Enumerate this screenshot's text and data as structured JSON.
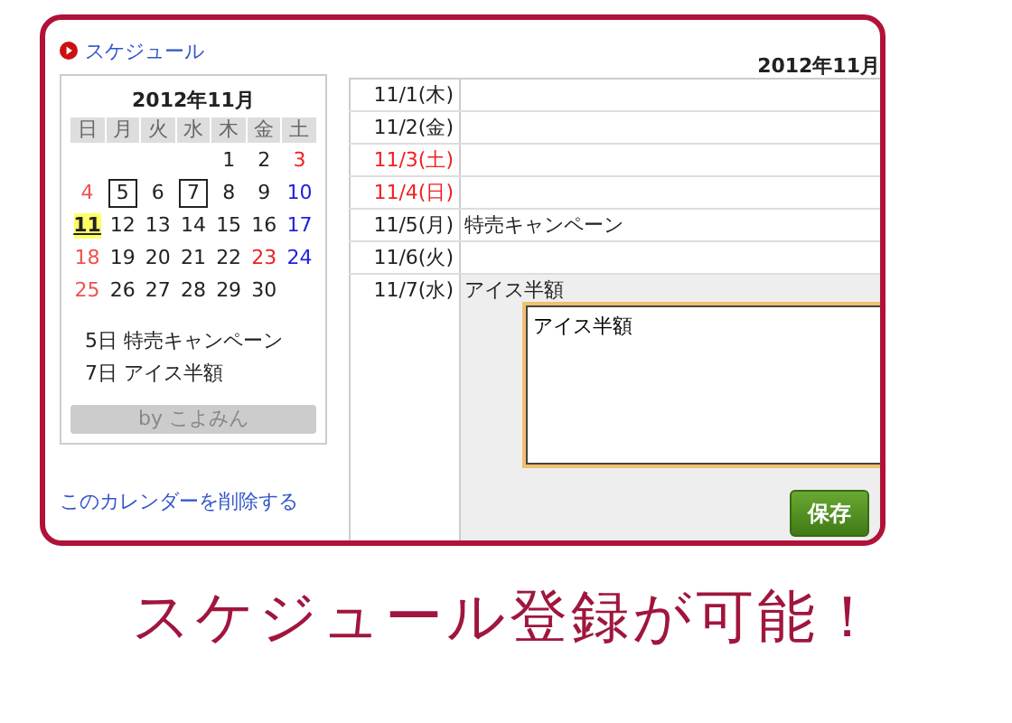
{
  "sidebar": {
    "link": "スケジュール",
    "calendar": {
      "title": "2012年11月",
      "weekdays": [
        {
          "label": "日"
        },
        {
          "label": "月"
        },
        {
          "label": "火"
        },
        {
          "label": "水"
        },
        {
          "label": "木"
        },
        {
          "label": "金"
        },
        {
          "label": "土"
        }
      ],
      "weeks": [
        [
          {
            "day": "1",
            "kind": "weekday",
            "has_event": false,
            "today": false
          },
          {
            "day": "2",
            "kind": "weekday",
            "has_event": false,
            "today": false
          },
          {
            "day": "3",
            "kind": "holiday",
            "has_event": false,
            "today": false
          }
        ],
        [
          {
            "day": "4",
            "kind": "sunday",
            "has_event": false,
            "today": false
          },
          {
            "day": "5",
            "kind": "weekday",
            "has_event": true,
            "today": false
          },
          {
            "day": "6",
            "kind": "weekday",
            "has_event": false,
            "today": false
          },
          {
            "day": "7",
            "kind": "weekday",
            "has_event": true,
            "today": false
          },
          {
            "day": "8",
            "kind": "weekday",
            "has_event": false,
            "today": false
          },
          {
            "day": "9",
            "kind": "weekday",
            "has_event": false,
            "today": false
          },
          {
            "day": "10",
            "kind": "saturday",
            "has_event": false,
            "today": false
          }
        ],
        [
          {
            "day": "11",
            "kind": "weekday",
            "has_event": false,
            "today": true
          },
          {
            "day": "12",
            "kind": "weekday",
            "has_event": false,
            "today": false
          },
          {
            "day": "13",
            "kind": "weekday",
            "has_event": false,
            "today": false
          },
          {
            "day": "14",
            "kind": "weekday",
            "has_event": false,
            "today": false
          },
          {
            "day": "15",
            "kind": "weekday",
            "has_event": false,
            "today": false
          },
          {
            "day": "16",
            "kind": "weekday",
            "has_event": false,
            "today": false
          },
          {
            "day": "17",
            "kind": "saturday",
            "has_event": false,
            "today": false
          }
        ],
        [
          {
            "day": "18",
            "kind": "sunday",
            "has_event": false,
            "today": false
          },
          {
            "day": "19",
            "kind": "weekday",
            "has_event": false,
            "today": false
          },
          {
            "day": "20",
            "kind": "weekday",
            "has_event": false,
            "today": false
          },
          {
            "day": "21",
            "kind": "weekday",
            "has_event": false,
            "today": false
          },
          {
            "day": "22",
            "kind": "weekday",
            "has_event": false,
            "today": false
          },
          {
            "day": "23",
            "kind": "holiday",
            "has_event": false,
            "today": false
          },
          {
            "day": "24",
            "kind": "saturday",
            "has_event": false,
            "today": false
          }
        ],
        [
          {
            "day": "25",
            "kind": "sunday",
            "has_event": false,
            "today": false
          },
          {
            "day": "26",
            "kind": "weekday",
            "has_event": false,
            "today": false
          },
          {
            "day": "27",
            "kind": "weekday",
            "has_event": false,
            "today": false
          },
          {
            "day": "28",
            "kind": "weekday",
            "has_event": false,
            "today": false
          },
          {
            "day": "29",
            "kind": "weekday",
            "has_event": false,
            "today": false
          },
          {
            "day": "30",
            "kind": "weekday",
            "has_event": false,
            "today": false
          }
        ]
      ],
      "events": [
        {
          "day": "5日",
          "title": "特売キャンペーン"
        },
        {
          "day": "7日",
          "title": "アイス半額"
        }
      ],
      "credit": "by こよみん"
    },
    "delete_link": "このカレンダーを削除する"
  },
  "schedule": {
    "title": "2012年11月",
    "rows": [
      {
        "date": "11/1(木)",
        "holiday": false,
        "selected": false
      },
      {
        "date": "11/2(金)",
        "holiday": false,
        "selected": false
      },
      {
        "date": "11/3(土)",
        "holiday": true,
        "selected": false
      },
      {
        "date": "11/4(日)",
        "holiday": true,
        "selected": false
      },
      {
        "date": "11/5(月)",
        "holiday": false,
        "event": "特売キャンペーン",
        "selected": false
      },
      {
        "date": "11/6(火)",
        "holiday": false,
        "selected": false
      },
      {
        "date": "11/7(水)",
        "holiday": false,
        "event": "アイス半額",
        "selected": true
      }
    ],
    "editor": {
      "value": "アイス半額",
      "save": "保存"
    }
  },
  "caption": "スケジュール登録が可能！"
}
